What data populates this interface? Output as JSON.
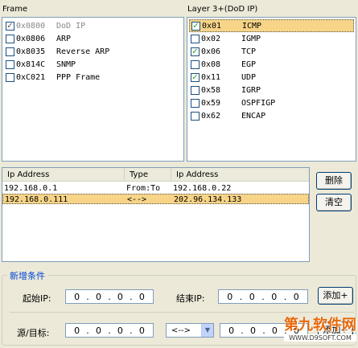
{
  "frame": {
    "label": "Frame",
    "items": [
      {
        "code": "0x0800",
        "name": "DoD IP",
        "checked": true,
        "disabled": true
      },
      {
        "code": "0x0806",
        "name": "ARP",
        "checked": false
      },
      {
        "code": "0x8035",
        "name": "Reverse ARP",
        "checked": false
      },
      {
        "code": "0x814C",
        "name": "SNMP",
        "checked": false
      },
      {
        "code": "0xC021",
        "name": "PPP Frame",
        "checked": false
      }
    ]
  },
  "layer3": {
    "label": "Layer 3+(DoD IP)",
    "items": [
      {
        "code": "0x01",
        "name": "ICMP",
        "checked": true,
        "selected": true
      },
      {
        "code": "0x02",
        "name": "IGMP",
        "checked": false
      },
      {
        "code": "0x06",
        "name": "TCP",
        "checked": true
      },
      {
        "code": "0x08",
        "name": "EGP",
        "checked": false
      },
      {
        "code": "0x11",
        "name": "UDP",
        "checked": true
      },
      {
        "code": "0x58",
        "name": "IGRP",
        "checked": false
      },
      {
        "code": "0x59",
        "name": "OSPFIGP",
        "checked": false
      },
      {
        "code": "0x62",
        "name": "ENCAP",
        "checked": false
      }
    ]
  },
  "ip_table": {
    "columns": [
      "Ip Address",
      "Type",
      "Ip Address"
    ],
    "rows": [
      {
        "src": "192.168.0.1",
        "type": "From:To",
        "dst": "192.168.0.22",
        "selected": false
      },
      {
        "src": "192.168.0.111",
        "type": "<-->",
        "dst": "202.96.134.133",
        "selected": true
      }
    ]
  },
  "buttons": {
    "delete": "删除",
    "clear": "清空",
    "add1": "添加+",
    "add2": "添加+"
  },
  "new_condition": {
    "legend": "新增条件",
    "start_ip_label": "起始IP:",
    "end_ip_label": "结束IP:",
    "src_dst_label": "源/目标:",
    "start_ip": [
      "0",
      "0",
      "0",
      "0"
    ],
    "end_ip": [
      "0",
      "0",
      "0",
      "0"
    ],
    "src_ip": [
      "0",
      "0",
      "0",
      "0"
    ],
    "dst_ip": [
      "0",
      "0",
      "0",
      "0"
    ],
    "direction": "<-->"
  },
  "watermark": {
    "text": "第九软件网",
    "url": "WWW.D9SOFT.COM"
  }
}
